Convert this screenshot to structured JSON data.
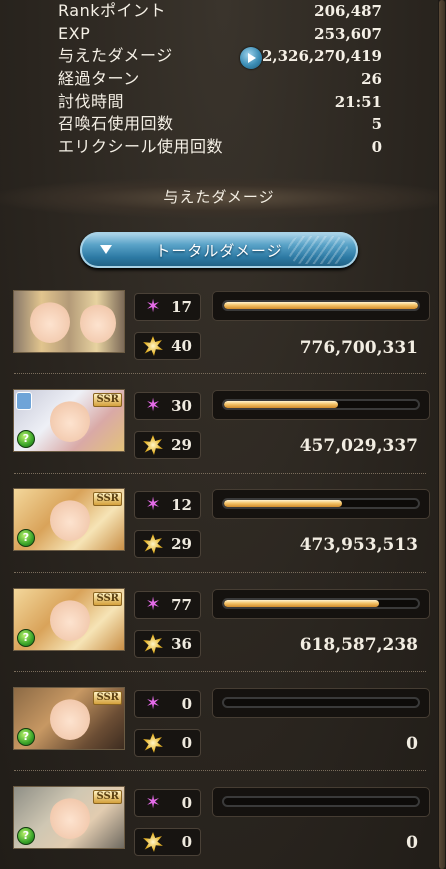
{
  "stats": [
    {
      "label": "Rankポイント",
      "value": "206,487"
    },
    {
      "label": "EXP",
      "value": "253,607"
    },
    {
      "label": "与えたダメージ",
      "value": "2,326,270,419"
    },
    {
      "label": "経過ターン",
      "value": "26"
    },
    {
      "label": "討伐時間",
      "value": "21:51"
    },
    {
      "label": "召喚石使用回数",
      "value": "5"
    },
    {
      "label": "エリクシール使用回数",
      "value": "0"
    }
  ],
  "section_title": "与えたダメージ",
  "total_button_label": "トータルダメージ",
  "characters": [
    {
      "star_count": "17",
      "burst_count": "40",
      "damage": "776,700,331",
      "bar_fraction": 1.0
    },
    {
      "star_count": "30",
      "burst_count": "29",
      "damage": "457,029,337",
      "bar_fraction": 0.59
    },
    {
      "star_count": "12",
      "burst_count": "29",
      "damage": "473,953,513",
      "bar_fraction": 0.61
    },
    {
      "star_count": "77",
      "burst_count": "36",
      "damage": "618,587,238",
      "bar_fraction": 0.8
    },
    {
      "star_count": "0",
      "burst_count": "0",
      "damage": "0",
      "bar_fraction": 0.0
    },
    {
      "star_count": "0",
      "burst_count": "0",
      "damage": "0",
      "bar_fraction": 0.0
    }
  ],
  "badges": {
    "rarity": "SSR"
  },
  "icons": {
    "expand": "play-icon",
    "dropdown": "triangle-down-icon",
    "star": "star-icon",
    "burst": "burst-icon",
    "element": "wind-element-icon"
  },
  "colors": {
    "bar_fill": "#f4c46a",
    "star": "#e46be8",
    "button": "#2d7aa4"
  }
}
